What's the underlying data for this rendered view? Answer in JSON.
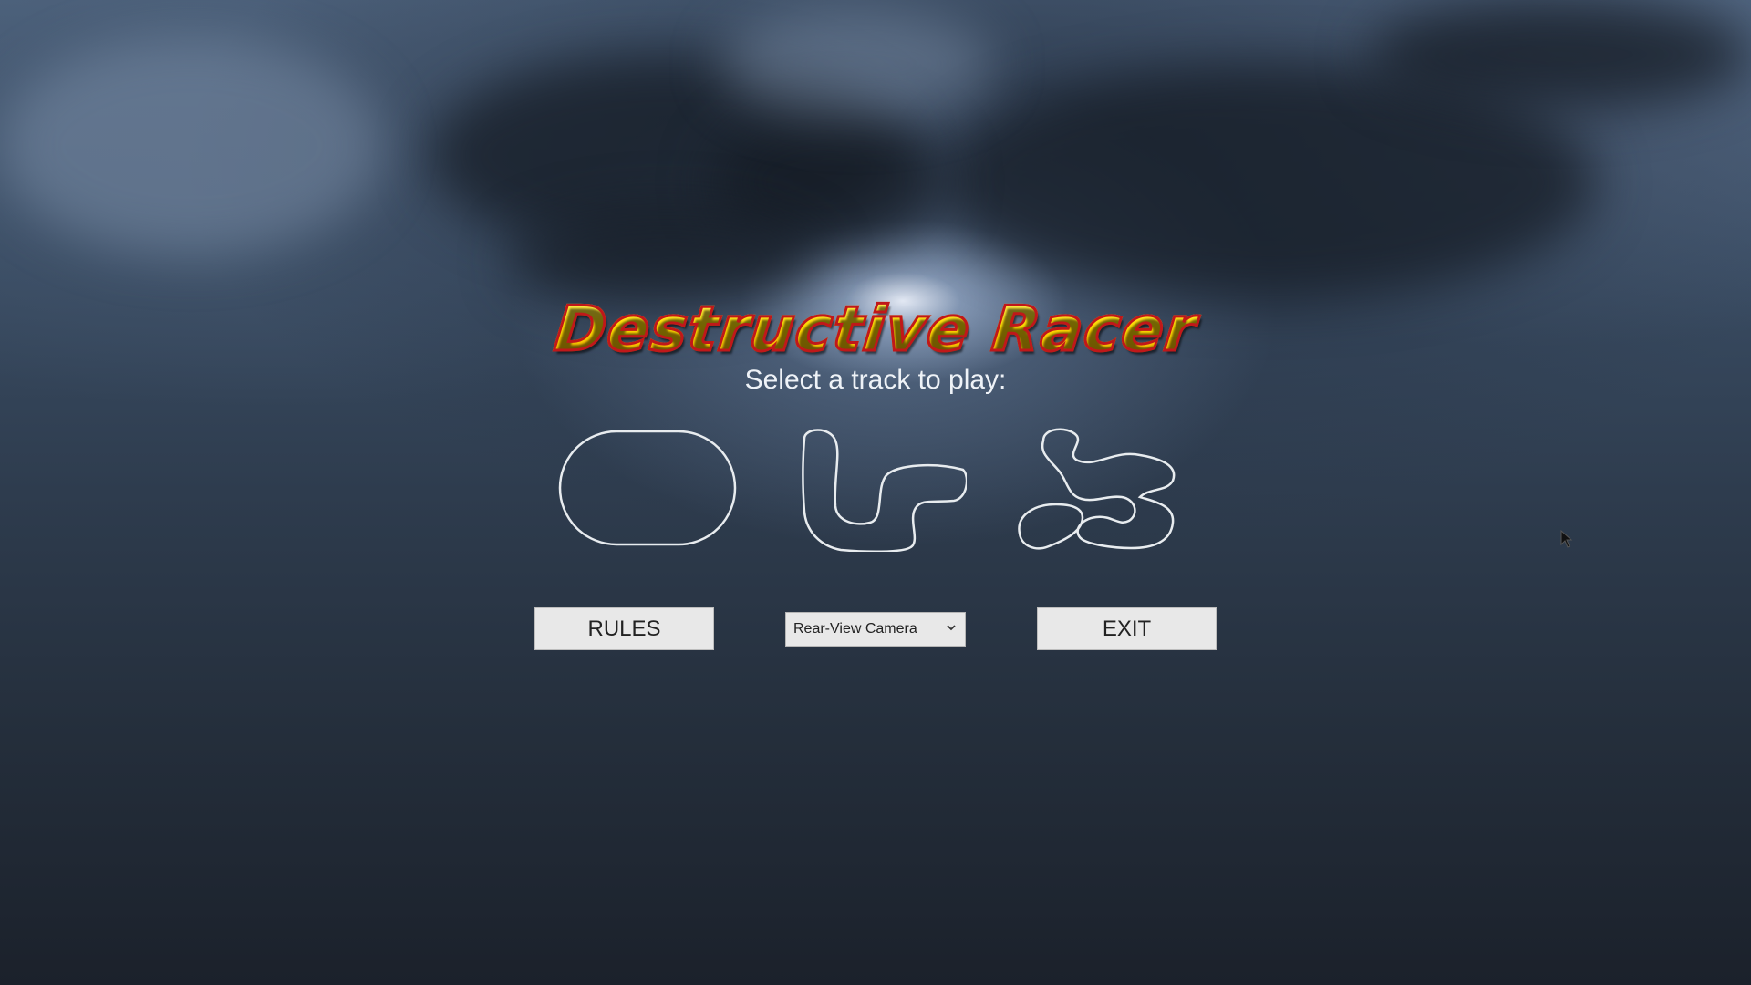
{
  "game": {
    "title": "Destructive Racer",
    "subtitle": "Select a track to play:"
  },
  "tracks": [
    {
      "name": "oval-track",
      "icon": "oval-track-icon"
    },
    {
      "name": "s-curve-track",
      "icon": "s-curve-track-icon"
    },
    {
      "name": "winding-track",
      "icon": "winding-track-icon"
    }
  ],
  "controls": {
    "rules_label": "RULES",
    "exit_label": "EXIT",
    "camera_select": {
      "selected": "Rear-View Camera"
    }
  },
  "colors": {
    "title_fill": "#ffdc00",
    "title_outline": "#c0181a",
    "track_outline": "#e8ecef",
    "button_bg": "#e8e8e8"
  }
}
